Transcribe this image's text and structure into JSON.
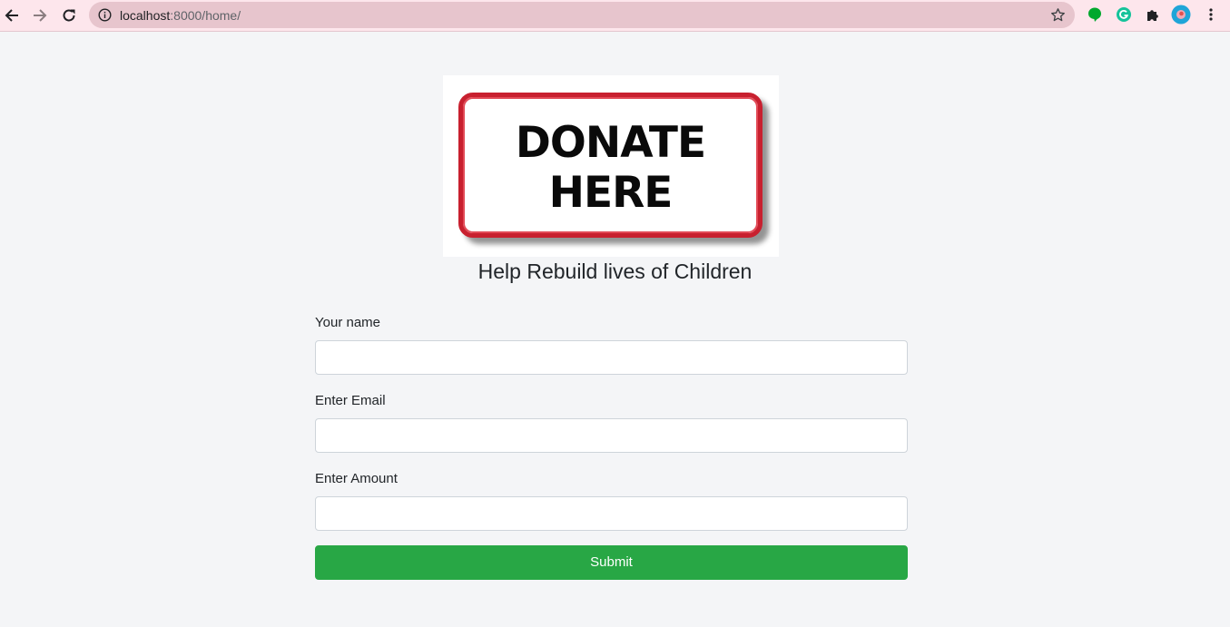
{
  "browser": {
    "url_host": "localhost",
    "url_path": ":8000/home/",
    "colors": {
      "tab_bar": "#fde6ec",
      "omnibox": "#e7c5cd"
    }
  },
  "logo": {
    "line1": "DONATE",
    "line2": "HERE",
    "border_color": "#c8202f"
  },
  "page": {
    "headline": "Help Rebuild lives of Children"
  },
  "form": {
    "name_label": "Your name",
    "name_value": "",
    "email_label": "Enter Email",
    "email_value": "",
    "amount_label": "Enter Amount",
    "amount_value": "",
    "submit_label": "Submit",
    "submit_color": "#28a745"
  }
}
